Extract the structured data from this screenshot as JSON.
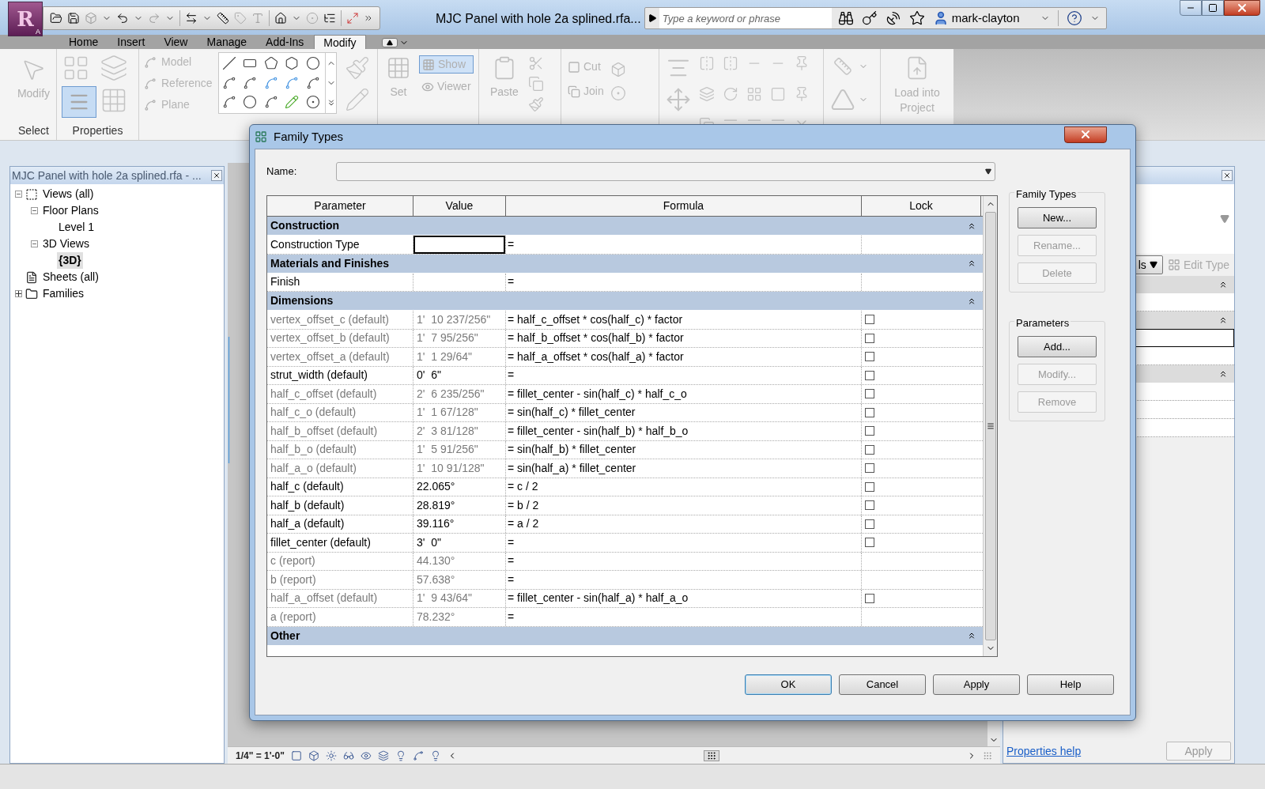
{
  "app_button": {
    "letter": "R",
    "sub": "A"
  },
  "title": "MJC Panel with hole 2a splined.rfa...",
  "search": {
    "placeholder": "Type a keyword or phrase"
  },
  "user": "mark-clayton",
  "ribbon_tabs": [
    {
      "label": "Home",
      "selected": false
    },
    {
      "label": "Insert",
      "selected": false
    },
    {
      "label": "View",
      "selected": false
    },
    {
      "label": "Manage",
      "selected": false
    },
    {
      "label": "Add-Ins",
      "selected": false
    },
    {
      "label": "Modify",
      "selected": true
    }
  ],
  "ribbon": {
    "modify": "Modify",
    "select_panel": "Select",
    "properties_panel": "Properties",
    "properties_button": {
      "selected": true
    },
    "work_plane": [
      "Model",
      "Reference",
      "Plane"
    ],
    "set": "Set",
    "show": {
      "label": "Show",
      "selected": true
    },
    "viewer": "Viewer",
    "paste": "Paste",
    "cut": "Cut",
    "join": "Join",
    "load": "Load into Project"
  },
  "project_browser": {
    "title": "MJC Panel with hole 2a splined.rfa - ...",
    "tree": [
      {
        "label": "Views (all)",
        "expanded": true,
        "selected": false,
        "children": [
          {
            "label": "Floor Plans",
            "expanded": true,
            "selected": false,
            "children": [
              {
                "label": "Level 1",
                "selected": false
              }
            ]
          },
          {
            "label": "3D Views",
            "expanded": true,
            "selected": false,
            "children": [
              {
                "label": "{3D}",
                "selected": true
              }
            ]
          }
        ]
      },
      {
        "label": "Sheets (all)",
        "selected": false
      },
      {
        "label": "Families",
        "expanded": false,
        "selected": false
      }
    ]
  },
  "view_bar": {
    "scale": "1/4\" = 1'-0\""
  },
  "properties_panel": {
    "type_dropdown": "ls",
    "edit_type": {
      "label": "Edit Type",
      "disabled": true
    },
    "sections": [
      {
        "expanded": true
      },
      {
        "expanded": true
      },
      {
        "expanded": true
      }
    ],
    "help_link": "Properties help",
    "apply": {
      "label": "Apply",
      "disabled": true
    }
  },
  "dialog": {
    "title": "Family Types",
    "name_label": "Name:",
    "columns": [
      "Parameter",
      "Value",
      "Formula",
      "Lock"
    ],
    "groups": [
      {
        "title": "Construction",
        "expanded": true,
        "rows": [
          {
            "parameter": "Construction Type",
            "value": "",
            "formula": "=",
            "kind": "plain",
            "disabled": false,
            "selected": true
          }
        ]
      },
      {
        "title": "Materials and Finishes",
        "expanded": true,
        "rows": [
          {
            "parameter": "Finish",
            "value": "",
            "formula": "=",
            "kind": "plain",
            "disabled": false,
            "selected": false
          }
        ]
      },
      {
        "title": "Dimensions",
        "expanded": true,
        "rows": [
          {
            "parameter": "vertex_offset_c (default)",
            "value": "1'  10 237/256\"",
            "formula": "= half_c_offset * cos(half_c) * factor",
            "kind": "lockable",
            "locked": false,
            "disabled": true,
            "selected": false
          },
          {
            "parameter": "vertex_offset_b (default)",
            "value": "1'  7 95/256\"",
            "formula": "= half_b_offset * cos(half_b) * factor",
            "kind": "lockable",
            "locked": false,
            "disabled": true,
            "selected": false
          },
          {
            "parameter": "vertex_offset_a (default)",
            "value": "1'  1 29/64\"",
            "formula": "= half_a_offset * cos(half_a) * factor",
            "kind": "lockable",
            "locked": false,
            "disabled": true,
            "selected": false
          },
          {
            "parameter": "strut_width (default)",
            "value": "0'  6\"",
            "formula": "=",
            "kind": "lockable",
            "locked": false,
            "disabled": false,
            "selected": false
          },
          {
            "parameter": "half_c_offset (default)",
            "value": "2'  6 235/256\"",
            "formula": "= fillet_center - sin(half_c) * half_c_o",
            "kind": "lockable",
            "locked": false,
            "disabled": true,
            "selected": false
          },
          {
            "parameter": "half_c_o (default)",
            "value": "1'  1 67/128\"",
            "formula": "= sin(half_c) * fillet_center",
            "kind": "lockable",
            "locked": false,
            "disabled": true,
            "selected": false
          },
          {
            "parameter": "half_b_offset (default)",
            "value": "2'  3 81/128\"",
            "formula": "= fillet_center - sin(half_b) * half_b_o",
            "kind": "lockable",
            "locked": false,
            "disabled": true,
            "selected": false
          },
          {
            "parameter": "half_b_o (default)",
            "value": "1'  5 91/256\"",
            "formula": "= sin(half_b) * fillet_center",
            "kind": "lockable",
            "locked": false,
            "disabled": true,
            "selected": false
          },
          {
            "parameter": "half_a_o (default)",
            "value": "1'  10 91/128\"",
            "formula": "= sin(half_a) * fillet_center",
            "kind": "lockable",
            "locked": false,
            "disabled": true,
            "selected": false
          },
          {
            "parameter": "half_c (default)",
            "value": "22.065°",
            "formula": "= c / 2",
            "kind": "lockable",
            "locked": false,
            "disabled": false,
            "selected": false
          },
          {
            "parameter": "half_b (default)",
            "value": "28.819°",
            "formula": "= b / 2",
            "kind": "lockable",
            "locked": false,
            "disabled": false,
            "selected": false
          },
          {
            "parameter": "half_a (default)",
            "value": "39.116°",
            "formula": "= a / 2",
            "kind": "lockable",
            "locked": false,
            "disabled": false,
            "selected": false
          },
          {
            "parameter": "fillet_center (default)",
            "value": "3'  0\"",
            "formula": "=",
            "kind": "lockable",
            "locked": false,
            "disabled": false,
            "selected": false
          },
          {
            "parameter": "c (report)",
            "value": "44.130°",
            "formula": "=",
            "kind": "plain",
            "disabled": true,
            "selected": false
          },
          {
            "parameter": "b (report)",
            "value": "57.638°",
            "formula": "=",
            "kind": "plain",
            "disabled": true,
            "selected": false
          },
          {
            "parameter": "half_a_offset (default)",
            "value": "1'  9 43/64\"",
            "formula": "= fillet_center - sin(half_a) * half_a_o",
            "kind": "lockable",
            "locked": false,
            "disabled": true,
            "selected": false
          },
          {
            "parameter": "a (report)",
            "value": "78.232°",
            "formula": "=",
            "kind": "plain",
            "disabled": true,
            "selected": false
          }
        ]
      },
      {
        "title": "Other",
        "expanded": true
      }
    ],
    "side_groups": [
      {
        "title": "Family Types",
        "buttons": [
          {
            "label": "New...",
            "disabled": false
          },
          {
            "label": "Rename...",
            "disabled": true
          },
          {
            "label": "Delete",
            "disabled": true
          }
        ]
      },
      {
        "title": "Parameters",
        "buttons": [
          {
            "label": "Add...",
            "disabled": false
          },
          {
            "label": "Modify...",
            "disabled": true
          },
          {
            "label": "Remove",
            "disabled": true
          }
        ]
      }
    ],
    "buttons": [
      {
        "label": "OK",
        "default": true
      },
      {
        "label": "Cancel",
        "default": false
      },
      {
        "label": "Apply",
        "default": false
      },
      {
        "label": "Help",
        "default": false
      }
    ]
  }
}
